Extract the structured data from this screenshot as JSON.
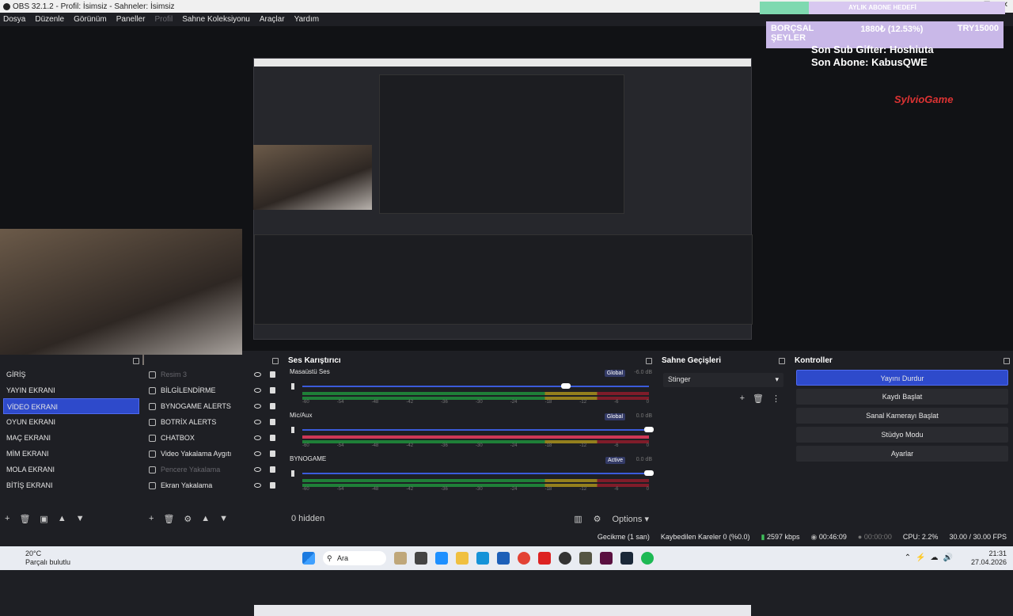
{
  "window": {
    "title": "OBS 32.1.2 - Profil: İsimsiz - Sahneler: İsimsiz"
  },
  "menu": [
    {
      "label": "Dosya",
      "enabled": true
    },
    {
      "label": "Düzenle",
      "enabled": true
    },
    {
      "label": "Görünüm",
      "enabled": true
    },
    {
      "label": "Paneller",
      "enabled": true
    },
    {
      "label": "Profil",
      "enabled": false
    },
    {
      "label": "Sahne Koleksiyonu",
      "enabled": true
    },
    {
      "label": "Araçlar",
      "enabled": true
    },
    {
      "label": "Yardım",
      "enabled": true
    }
  ],
  "overlay": {
    "banner": "AYLIK ABONE HEDEFİ",
    "goal_left": "BORÇSAL ŞEYLER",
    "goal_mid": "1880₺ (12.53%)",
    "goal_right": "TRY15000",
    "sub_gifter": "Son Sub Gifter: Hoshiuta",
    "last_sub": "Son Abone: KabusQWE",
    "logo": "SylvioGame"
  },
  "scenes": {
    "items": [
      "GİRİŞ",
      "YAYIN EKRANI",
      "VİDEO EKRANI",
      "OYUN EKRANI",
      "MAÇ EKRANI",
      "MİM EKRANI",
      "MOLA EKRANI",
      "BİTİŞ EKRANI"
    ],
    "active_index": 2
  },
  "sources": {
    "items": [
      {
        "label": "Resim 3",
        "visible": false,
        "icon": "image-icon"
      },
      {
        "label": "BİLGİLENDİRME",
        "visible": true,
        "icon": "folder-icon"
      },
      {
        "label": "BYNOGAME ALERTS",
        "visible": true,
        "icon": "globe-icon"
      },
      {
        "label": "BOTRİX ALERTS",
        "visible": true,
        "icon": "globe-icon"
      },
      {
        "label": "CHATBOX",
        "visible": true,
        "icon": "globe-icon"
      },
      {
        "label": "Video Yakalama Aygıtı",
        "visible": true,
        "icon": "camera-icon"
      },
      {
        "label": "Pencere Yakalama",
        "visible": false,
        "icon": "window-icon"
      },
      {
        "label": "Ekran Yakalama",
        "visible": true,
        "icon": "monitor-icon"
      }
    ]
  },
  "mixer": {
    "title": "Ses Karıştırıcı",
    "channels": [
      {
        "name": "Masaüstü Ses",
        "badge": "Global",
        "db": "-6.0 dB",
        "volume": 0.76,
        "muted": false
      },
      {
        "name": "Mic/Aux",
        "badge": "Global",
        "db": "0.0 dB",
        "volume": 1.0,
        "muted": false
      },
      {
        "name": "BYNOGAME",
        "badge": "Active",
        "db": "0.0 dB",
        "volume": 1.0,
        "muted": false
      }
    ],
    "ticks": [
      "-60",
      "-54",
      "-48",
      "-42",
      "-36",
      "-30",
      "-24",
      "-18",
      "-12",
      "-6",
      "0"
    ],
    "hidden_label": "0 hidden",
    "options_label": "Options"
  },
  "transitions": {
    "title": "Sahne Geçişleri",
    "selected": "Stinger"
  },
  "controls": {
    "title": "Kontroller",
    "buttons": [
      "Yayını Durdur",
      "Kaydı Başlat",
      "Sanal Kamerayı Başlat",
      "Stüdyo Modu",
      "Ayarlar"
    ]
  },
  "status": {
    "delay": "Gecikme (1 san)",
    "dropped": "Kaybedilen Kareler 0 (%0.0)",
    "bitrate": "2597 kbps",
    "stream_time": "00:46:09",
    "rec_time": "00:00:00",
    "cpu": "CPU: 2.2%",
    "fps": "30.00 / 30.00 FPS"
  },
  "taskbar": {
    "weather_temp": "20°C",
    "weather_desc": "Parçalı bulutlu",
    "search": "Ara",
    "time": "21:31",
    "date": "27.04.2026"
  },
  "colors": {
    "accent": "#2e4acb",
    "panel": "#1e1f24",
    "meter_red": "#e03a5c"
  }
}
